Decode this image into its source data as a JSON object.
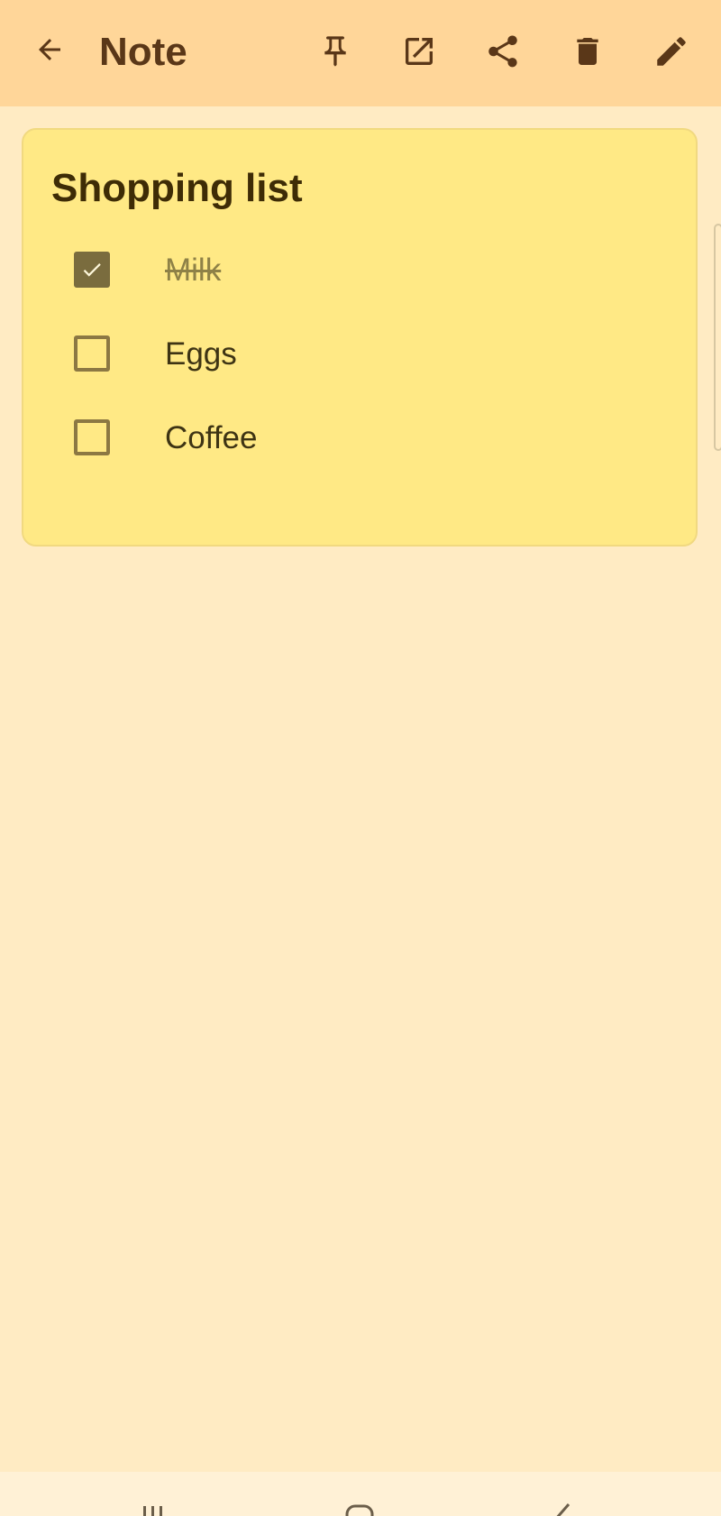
{
  "header": {
    "title": "Note",
    "icons": {
      "back": "arrow-back-icon",
      "pin": "pin-icon",
      "open": "open-external-icon",
      "share": "share-icon",
      "delete": "trash-icon",
      "edit": "pencil-icon"
    }
  },
  "note": {
    "title": "Shopping list",
    "items": [
      {
        "label": "Milk",
        "checked": true
      },
      {
        "label": "Eggs",
        "checked": false
      },
      {
        "label": "Coffee",
        "checked": false
      }
    ]
  },
  "colors": {
    "appbar": "#FFD699",
    "background": "#FFEBC3",
    "card": "#FFE985",
    "icon": "#5A3718"
  },
  "navigation": {
    "icons": [
      "recent-apps-icon",
      "home-icon",
      "back-nav-icon"
    ]
  }
}
